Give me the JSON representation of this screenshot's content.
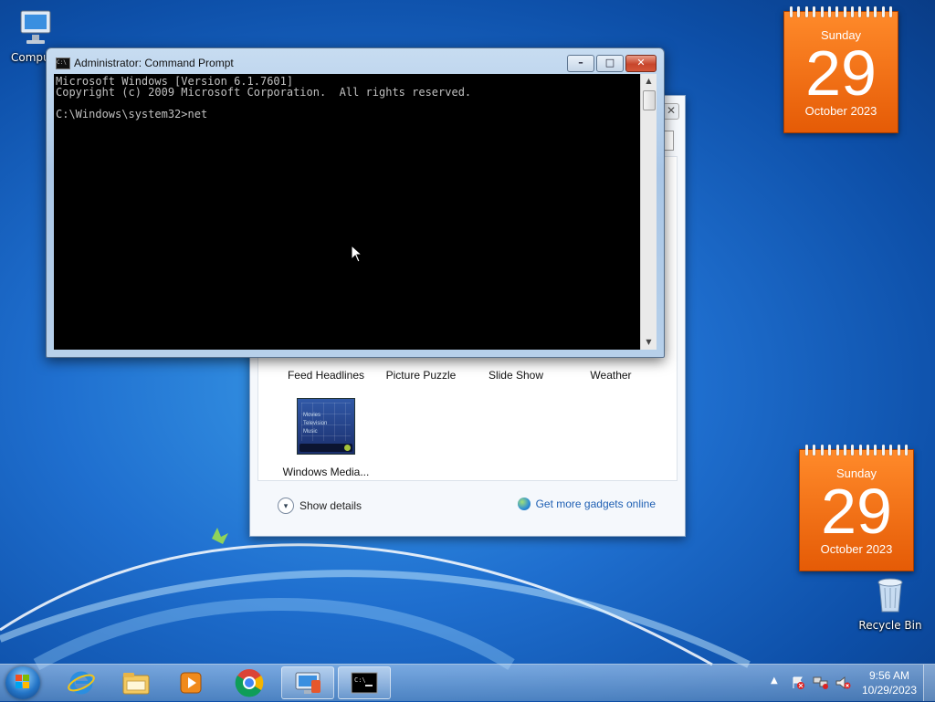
{
  "desktop": {
    "icons": [
      {
        "label": "Compu"
      },
      {
        "label": "Recycle Bin"
      }
    ]
  },
  "calendars": [
    {
      "weekday": "Sunday",
      "day": "29",
      "month_year": "October 2023"
    },
    {
      "weekday": "Sunday",
      "day": "29",
      "month_year": "October 2023"
    }
  ],
  "gadget_gallery": {
    "gadgets": [
      {
        "label": "Feed Headlines"
      },
      {
        "label": "Picture Puzzle"
      },
      {
        "label": "Slide Show"
      },
      {
        "label": "Weather"
      },
      {
        "label": "Windows Media..."
      }
    ],
    "wmc_thumb_lines": [
      "Movies",
      "Television",
      "Music"
    ],
    "show_details": "Show details",
    "get_more": "Get more gadgets online"
  },
  "cmd": {
    "title": "Administrator: Command Prompt",
    "lines": [
      "Microsoft Windows [Version 6.1.7601]",
      "Copyright (c) 2009 Microsoft Corporation.  All rights reserved.",
      "",
      "C:\\Windows\\system32>net"
    ]
  },
  "taskbar": {
    "apps": [
      {
        "icon": "internet-explorer-icon"
      },
      {
        "icon": "file-explorer-icon"
      },
      {
        "icon": "media-player-icon"
      },
      {
        "icon": "chrome-icon"
      },
      {
        "icon": "desktop-gadgets-icon"
      },
      {
        "icon": "command-prompt-icon"
      }
    ],
    "clock_time": "9:56 AM",
    "clock_date": "10/29/2023"
  }
}
